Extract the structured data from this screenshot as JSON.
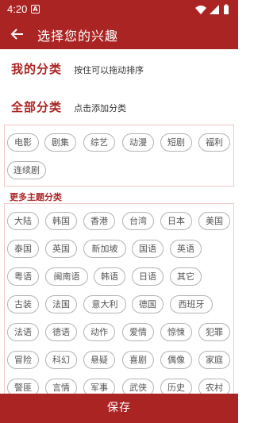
{
  "status_bar": {
    "time": "4:20",
    "notification_icon": "A"
  },
  "header": {
    "title": "选择您的兴趣",
    "back_icon": "arrow-left-icon"
  },
  "my_categories": {
    "title": "我的分类",
    "hint": "按住可以拖动排序"
  },
  "all_categories": {
    "title": "全部分类",
    "hint": "点击添加分类"
  },
  "main_tags": [
    "电影",
    "剧集",
    "综艺",
    "动漫",
    "短剧",
    "福利",
    "连续剧"
  ],
  "more_title": "更多主题分类",
  "more_tags": [
    [
      "大陆",
      "韩国",
      "香港",
      "台湾",
      "日本",
      "美国"
    ],
    [
      "泰国",
      "英国",
      "新加坡",
      "国语",
      "英语"
    ],
    [
      "粤语",
      "闽南语",
      "韩语",
      "日语",
      "其它"
    ],
    [
      "古装",
      "法国",
      "意大利",
      "德国",
      "西班牙"
    ],
    [
      "法语",
      "德语",
      "动作",
      "爱情",
      "惊悚",
      "犯罪"
    ],
    [
      "冒险",
      "科幻",
      "悬疑",
      "喜剧",
      "偶像",
      "家庭"
    ],
    [
      "警匪",
      "言情",
      "军事",
      "武侠",
      "历史",
      "农村"
    ]
  ],
  "save_label": "保存",
  "colors": {
    "accent": "#ab2424",
    "tag_border": "#b3b3b3"
  }
}
